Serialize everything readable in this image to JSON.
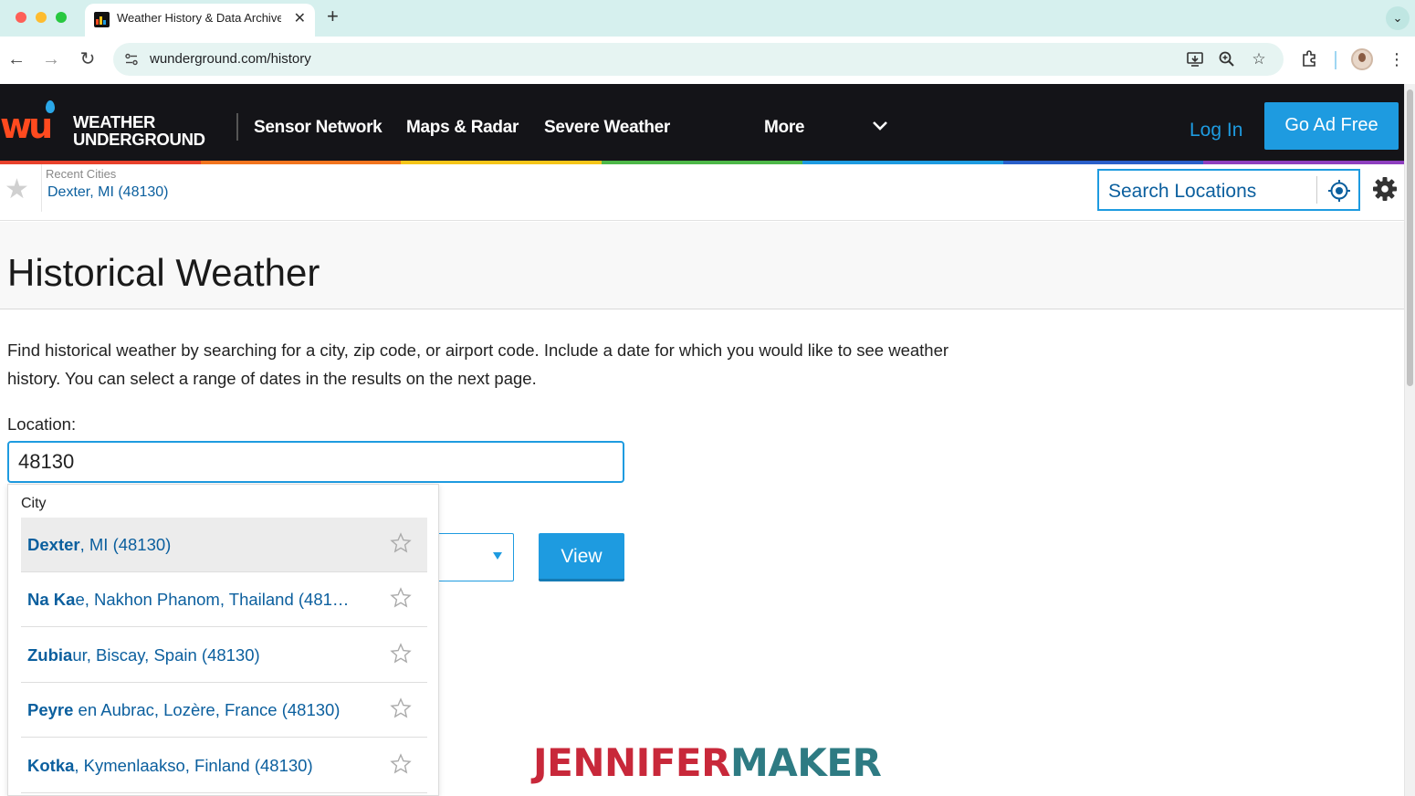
{
  "browser": {
    "tab_title": "Weather History & Data Archive",
    "url": "wunderground.com/history",
    "new_tab": "+",
    "tab_close": "✕"
  },
  "header": {
    "logo_line1": "WEATHER",
    "logo_line2": "UNDERGROUND",
    "logo_mark": "wu",
    "nav": [
      "Sensor Network",
      "Maps & Radar",
      "Severe Weather",
      "More"
    ],
    "login": "Log In",
    "ad_free": "Go Ad Free",
    "accent_color": "#1e9be0",
    "rainbow_colors": [
      "#e8412c",
      "#f2751f",
      "#f5c518",
      "#4db848",
      "#1e9be0",
      "#2a5fc9",
      "#8e3fbf"
    ]
  },
  "subheader": {
    "recent_label": "Recent Cities",
    "recent_city": "Dexter, MI (48130)",
    "search_placeholder": "Search Locations"
  },
  "page": {
    "title": "Historical Weather",
    "intro": "Find historical weather by searching for a city, zip code, or airport code. Include a date for which you would like to see weather history. You can select a range of dates in the results on the next page.",
    "location_label": "Location:",
    "location_value": "48130",
    "view_button": "View"
  },
  "dropdown": {
    "heading": "City",
    "items": [
      {
        "bold": "Dexter",
        "rest": ", MI (48130)"
      },
      {
        "bold": "Na Ka",
        "rest": "e, Nakhon Phanom, Thailand (481…"
      },
      {
        "bold": "Zubia",
        "rest": "ur, Biscay, Spain (48130)"
      },
      {
        "bold": "Peyre",
        "rest": " en Aubrac, Lozère, France (48130)"
      },
      {
        "bold": "Kotka",
        "rest": ", Kymenlaakso, Finland (48130)"
      }
    ]
  },
  "watermark": {
    "part1": "JENNIFER",
    "part2": "MAKER"
  }
}
